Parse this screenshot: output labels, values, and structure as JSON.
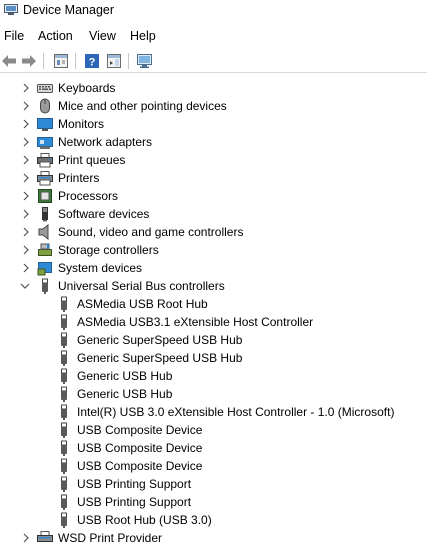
{
  "window": {
    "title": "Device Manager"
  },
  "menu": [
    "File",
    "Action",
    "View",
    "Help"
  ],
  "toolbar": {
    "buttons": [
      {
        "name": "back-arrow-icon"
      },
      {
        "name": "forward-arrow-icon"
      },
      {
        "name": "properties-icon"
      },
      {
        "name": "help-icon"
      },
      {
        "name": "action-pane-icon"
      },
      {
        "name": "monitor-scan-icon"
      }
    ]
  },
  "tree": {
    "categories": [
      {
        "label": "Keyboards",
        "icon": "keyboard-icon",
        "expanded": false
      },
      {
        "label": "Mice and other pointing devices",
        "icon": "mouse-icon",
        "expanded": false
      },
      {
        "label": "Monitors",
        "icon": "monitor-icon",
        "expanded": false
      },
      {
        "label": "Network adapters",
        "icon": "network-adapter-icon",
        "expanded": false
      },
      {
        "label": "Print queues",
        "icon": "print-queue-icon",
        "expanded": false
      },
      {
        "label": "Printers",
        "icon": "printer-icon",
        "expanded": false
      },
      {
        "label": "Processors",
        "icon": "processor-icon",
        "expanded": false
      },
      {
        "label": "Software devices",
        "icon": "software-device-icon",
        "expanded": false
      },
      {
        "label": "Sound, video and game controllers",
        "icon": "speaker-icon",
        "expanded": false
      },
      {
        "label": "Storage controllers",
        "icon": "storage-controller-icon",
        "expanded": false
      },
      {
        "label": "System devices",
        "icon": "system-devices-icon",
        "expanded": false
      },
      {
        "label": "Universal Serial Bus controllers",
        "icon": "usb-icon",
        "expanded": true
      }
    ],
    "usb_devices": [
      "ASMedia USB Root Hub",
      "ASMedia USB3.1 eXtensible Host Controller",
      "Generic SuperSpeed USB Hub",
      "Generic SuperSpeed USB Hub",
      "Generic USB Hub",
      "Generic USB Hub",
      "Intel(R) USB 3.0 eXtensible Host Controller - 1.0 (Microsoft)",
      "USB Composite Device",
      "USB Composite Device",
      "USB Composite Device",
      "USB Printing Support",
      "USB Printing Support",
      "USB Root Hub (USB 3.0)"
    ],
    "trailing_category": {
      "label": "WSD Print Provider",
      "icon": "wsd-print-provider-icon"
    }
  },
  "colors": {
    "accent": "#1e7fd4",
    "chevron": "#555555",
    "separator": "#d9d9d9"
  }
}
